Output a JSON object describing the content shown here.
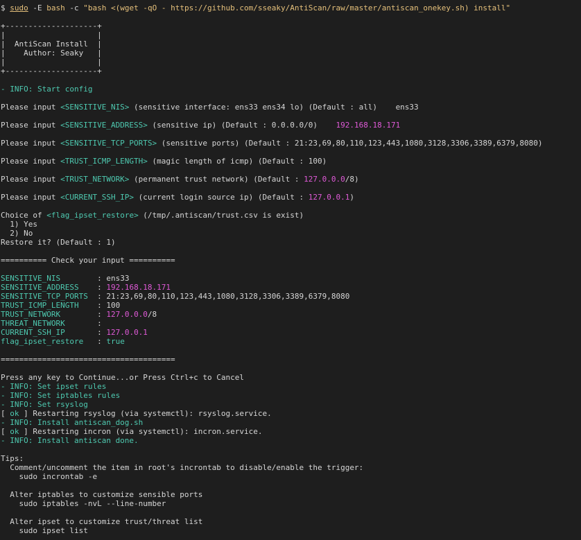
{
  "command": {
    "prompt": "$",
    "sudo": "sudo",
    "flag_e": "-E",
    "bash": "bash",
    "flag_c": "-c",
    "argument": "\"bash <(wget -qO - https://github.com/sseaky/AntiScan/raw/master/antiscan_onekey.sh) install\""
  },
  "banner": {
    "top_border": "+--------------------+",
    "empty_row": "|                    |",
    "title_row": "|  AntiScan Install  |",
    "author_row": "|    Author: Seaky   |",
    "bottom_border": "+--------------------+"
  },
  "info_start": "- INFO: Start config",
  "prompts": [
    {
      "prefix": "Please input ",
      "var": "<SENSITIVE_NIS>",
      "desc": " (sensitive interface: ens33 ens34 lo) (Default : all)",
      "gap": "    ",
      "answer": "ens33",
      "answer_color": "w",
      "suffix": ""
    },
    {
      "prefix": "Please input ",
      "var": "<SENSITIVE_ADDRESS>",
      "desc": " (sensitive ip) (Default : 0.0.0.0/0)",
      "gap": "    ",
      "answer": "192.168.18.171",
      "answer_color": "m",
      "suffix": ""
    },
    {
      "prefix": "Please input ",
      "var": "<SENSITIVE_TCP_PORTS>",
      "desc": " (sensitive ports) (Default : 21:23,69,80,110,123,443,1080,3128,3306,3389,6379,8080)",
      "gap": "",
      "answer": "",
      "answer_color": "w",
      "suffix": ""
    },
    {
      "prefix": "Please input ",
      "var": "<TRUST_ICMP_LENGTH>",
      "desc": " (magic length of icmp) (Default : 100)",
      "gap": "",
      "answer": "",
      "answer_color": "w",
      "suffix": ""
    },
    {
      "prefix": "Please input ",
      "var": "<TRUST_NETWORK>",
      "desc": " (permanent trust network) (Default : ",
      "gap": "",
      "answer": "127.0.0.0",
      "answer_color": "m",
      "suffix": "/8)"
    },
    {
      "prefix": "Please input ",
      "var": "<CURRENT_SSH_IP>",
      "desc": " (current login source ip) (Default : ",
      "gap": "",
      "answer": "127.0.0.1",
      "answer_color": "m",
      "suffix": ")"
    }
  ],
  "choice": {
    "prefix": "Choice of ",
    "var": "<flag_ipset_restore>",
    "desc": " (/tmp/.antiscan/trust.csv is exist)",
    "option_1": "  1) Yes",
    "option_2": "  2) No",
    "restore": "Restore it? (Default : 1)"
  },
  "check_header": "========== Check your input ==========",
  "summary": [
    {
      "key": "SENSITIVE_NIS       ",
      "sep": " : ",
      "value": "ens33",
      "value_color": "w",
      "suffix": ""
    },
    {
      "key": "SENSITIVE_ADDRESS   ",
      "sep": " : ",
      "value": "192.168.18.171",
      "value_color": "m",
      "suffix": ""
    },
    {
      "key": "SENSITIVE_TCP_PORTS ",
      "sep": " : ",
      "value": "21:23,69,80,110,123,443,1080,3128,3306,3389,6379,8080",
      "value_color": "w",
      "suffix": ""
    },
    {
      "key": "TRUST_ICMP_LENGTH   ",
      "sep": " : ",
      "value": "100",
      "value_color": "w",
      "suffix": ""
    },
    {
      "key": "TRUST_NETWORK       ",
      "sep": " : ",
      "value": "127.0.0.0",
      "value_color": "m",
      "suffix": "/8"
    },
    {
      "key": "THREAT_NETWORK      ",
      "sep": " : ",
      "value": "",
      "value_color": "w",
      "suffix": ""
    },
    {
      "key": "CURRENT_SSH_IP      ",
      "sep": " : ",
      "value": "127.0.0.1",
      "value_color": "m",
      "suffix": ""
    },
    {
      "key": "flag_ipset_restore  ",
      "sep": " : ",
      "value": "true",
      "value_color": "g",
      "suffix": ""
    }
  ],
  "divider": "======================================",
  "press_any_key": "Press any key to Continue...or Press Ctrl+c to Cancel",
  "progress": [
    {
      "type": "info",
      "text": "- INFO: Set ipset rules"
    },
    {
      "type": "info",
      "text": "- INFO: Set iptables rules"
    },
    {
      "type": "info",
      "text": "- INFO: Set rsyslog"
    },
    {
      "type": "ok",
      "open": "[ ",
      "ok": "ok",
      "close": " ] ",
      "text": "Restarting rsyslog (via systemctl): rsyslog.service."
    },
    {
      "type": "info",
      "text": "- INFO: Install antiscan_dog.sh"
    },
    {
      "type": "ok",
      "open": "[ ",
      "ok": "ok",
      "close": " ] ",
      "text": "Restarting incron (via systemctl): incron.service."
    },
    {
      "type": "info",
      "text": "- INFO: Install antiscan done."
    }
  ],
  "tips": {
    "title": "Tips:",
    "lines": [
      "  Comment/uncomment the item in root's incrontab to disable/enable the trigger:",
      "    sudo incrontab -e",
      "",
      "  Alter iptables to customize sensible ports",
      "    sudo iptables -nvL --line-number",
      "",
      "  Alter ipset to customize trust/threat list",
      "    sudo ipset list"
    ]
  },
  "colors": {
    "background": "#1e1e1e",
    "text": "#d6d6d6",
    "info_green": "#4ec9b0",
    "value_magenta": "#e05ad8",
    "command_yellow": "#e5c07b"
  }
}
